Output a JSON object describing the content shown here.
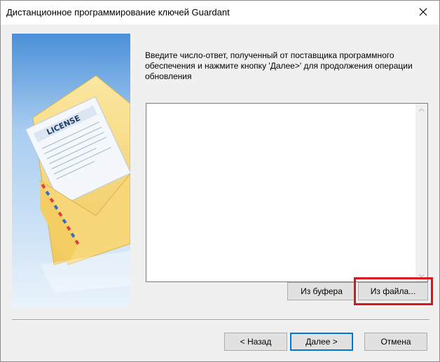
{
  "window": {
    "title": "Дистанционное программирование ключей Guardant",
    "close_icon": "close-icon"
  },
  "banner": {
    "image": "license-envelope-illustration",
    "license_text": "LICENSE"
  },
  "instruction": {
    "text": "Введите число-ответ, полученный от поставщика программного обеспечения и нажмите кнопку 'Далее>' для продолжения операции обновления"
  },
  "response_field": {
    "value": "",
    "placeholder": ""
  },
  "buttons": {
    "from_clipboard": "Из буфера",
    "from_file": "Из файла...",
    "back": "< Назад",
    "next": "Далее >",
    "cancel": "Отмена"
  },
  "colors": {
    "highlight": "#d8141f",
    "default_button_border": "#0078d7",
    "banner_top": "#4a90d9",
    "banner_bottom": "#eaf3fb"
  }
}
